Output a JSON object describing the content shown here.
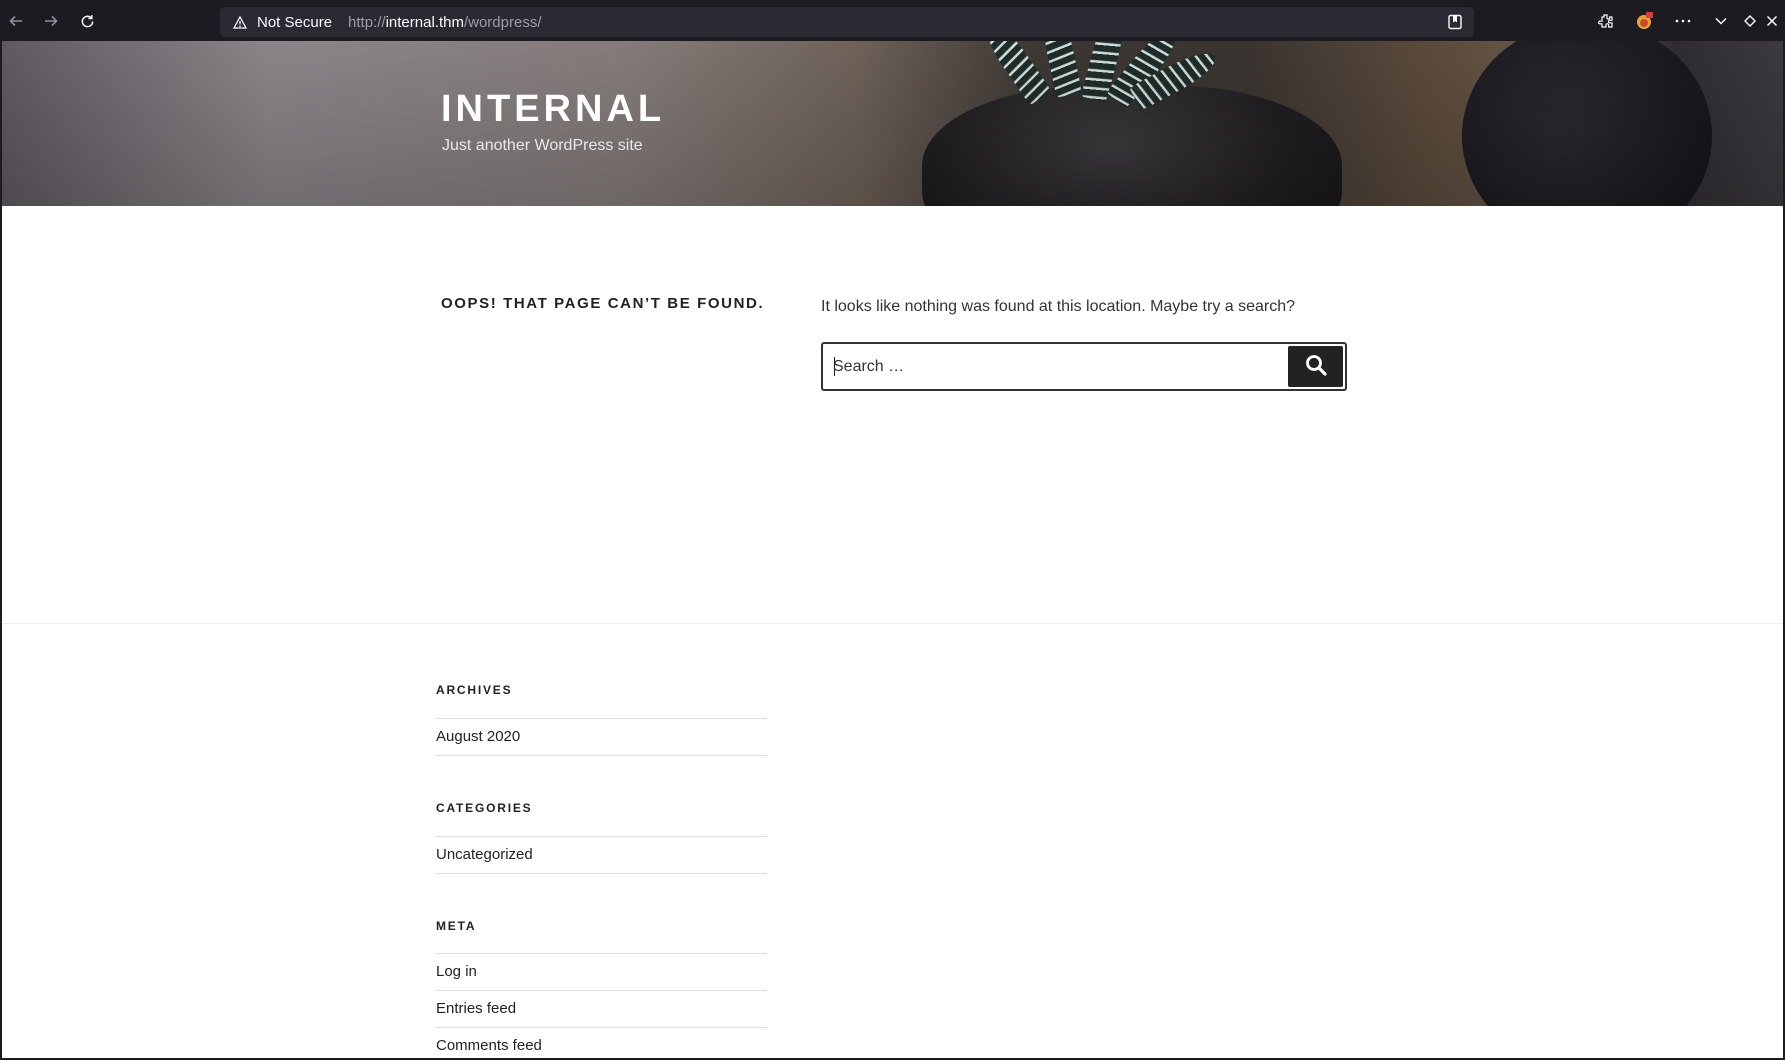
{
  "browser": {
    "security_label": "Not Secure",
    "url_prefix": "http://",
    "url_host": "internal.thm",
    "url_path": "/wordpress/",
    "icons": [
      "back-icon",
      "forward-icon",
      "reload-icon",
      "warning-icon",
      "reader-mode-icon",
      "extensions-icon",
      "profile-icon",
      "menu-icon",
      "list-all-tabs-icon",
      "window-icon",
      "close-icon"
    ]
  },
  "site": {
    "title": "INTERNAL",
    "description": "Just another WordPress site"
  },
  "main": {
    "page_title": "Oops! That page can’t be found.",
    "message": "It looks like nothing was found at this location. Maybe try a search?",
    "search": {
      "placeholder": "Search …",
      "value": ""
    }
  },
  "footer": {
    "archives": {
      "title": "Archives",
      "items": [
        "August 2020"
      ]
    },
    "categories": {
      "title": "Categories",
      "items": [
        "Uncategorized"
      ]
    },
    "meta": {
      "title": "Meta",
      "items": [
        "Log in",
        "Entries feed",
        "Comments feed"
      ]
    }
  }
}
